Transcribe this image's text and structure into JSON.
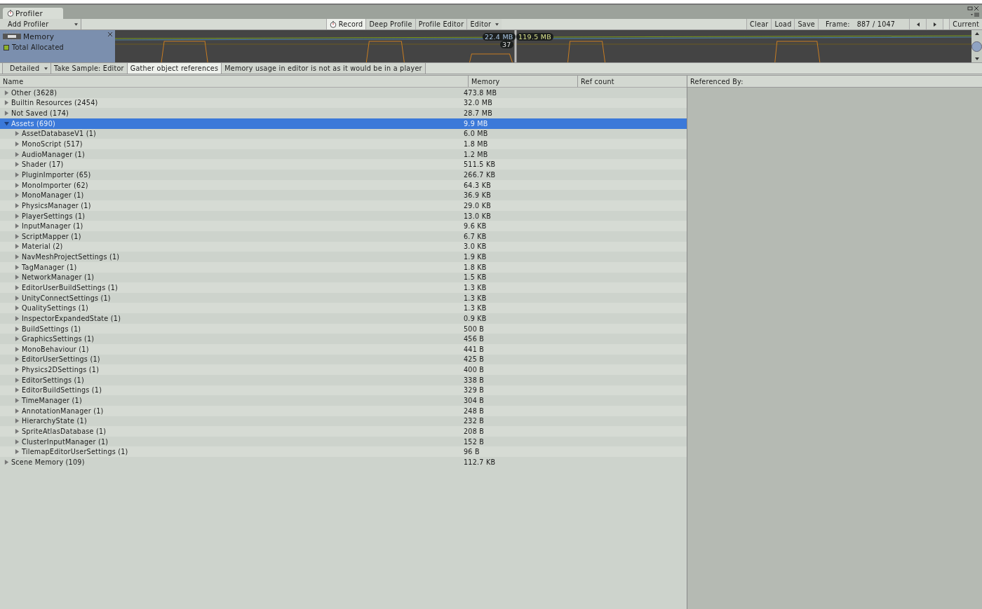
{
  "window": {
    "tab": "Profiler"
  },
  "toolbar": {
    "add_profiler": "Add Profiler",
    "buttons": [
      {
        "label": "Record",
        "kind": "record",
        "selected": true
      },
      {
        "label": "Deep Profile",
        "kind": "plain",
        "selected": false
      },
      {
        "label": "Profile Editor",
        "kind": "plain",
        "selected": false
      },
      {
        "label": "Editor",
        "kind": "dropdown",
        "selected": false
      }
    ],
    "right_buttons": [
      "Clear",
      "Load",
      "Save"
    ],
    "frame_label": "Frame:",
    "frame_value": "887 / 1047",
    "current": "Current"
  },
  "memory_panel": {
    "title": "Memory",
    "legend": [
      {
        "label": "Total Allocated",
        "color": "#8db32c"
      }
    ],
    "tooltips": [
      {
        "text": "22.4 MB",
        "kind": "blue"
      },
      {
        "text": "119.5 MB",
        "kind": "green"
      },
      {
        "text": "37",
        "kind": "plain"
      }
    ]
  },
  "detail_bar": {
    "mode": "Detailed",
    "buttons": [
      {
        "label": "Take Sample: Editor",
        "selected": false
      },
      {
        "label": "Gather object references",
        "selected": true
      }
    ],
    "notice": "Memory usage in editor is not as it would be in a player"
  },
  "table": {
    "columns": [
      "Name",
      "Memory",
      "Ref count"
    ],
    "rows": [
      {
        "name": "Other (3628)",
        "memory": "473.8 MB",
        "expanded": false,
        "selected": false
      },
      {
        "name": "Builtin Resources (2454)",
        "memory": "32.0 MB",
        "expanded": false,
        "selected": false
      },
      {
        "name": "Not Saved (174)",
        "memory": "28.7 MB",
        "expanded": false,
        "selected": false
      },
      {
        "name": "Assets (690)",
        "memory": "9.9 MB",
        "expanded": true,
        "selected": true,
        "children": [
          {
            "name": "AssetDatabaseV1 (1)",
            "memory": "6.0 MB",
            "expanded": false,
            "selected": false
          },
          {
            "name": "MonoScript (517)",
            "memory": "1.8 MB",
            "expanded": false,
            "selected": false
          },
          {
            "name": "AudioManager (1)",
            "memory": "1.2 MB",
            "expanded": false,
            "selected": false
          },
          {
            "name": "Shader (17)",
            "memory": "511.5 KB",
            "expanded": false,
            "selected": false
          },
          {
            "name": "PluginImporter (65)",
            "memory": "266.7 KB",
            "expanded": false,
            "selected": false
          },
          {
            "name": "MonoImporter (62)",
            "memory": "64.3 KB",
            "expanded": false,
            "selected": false
          },
          {
            "name": "MonoManager (1)",
            "memory": "36.9 KB",
            "expanded": false,
            "selected": false
          },
          {
            "name": "PhysicsManager (1)",
            "memory": "29.0 KB",
            "expanded": false,
            "selected": false
          },
          {
            "name": "PlayerSettings (1)",
            "memory": "13.0 KB",
            "expanded": false,
            "selected": false
          },
          {
            "name": "InputManager (1)",
            "memory": "9.6 KB",
            "expanded": false,
            "selected": false
          },
          {
            "name": "ScriptMapper (1)",
            "memory": "6.7 KB",
            "expanded": false,
            "selected": false
          },
          {
            "name": "Material (2)",
            "memory": "3.0 KB",
            "expanded": false,
            "selected": false
          },
          {
            "name": "NavMeshProjectSettings (1)",
            "memory": "1.9 KB",
            "expanded": false,
            "selected": false
          },
          {
            "name": "TagManager (1)",
            "memory": "1.8 KB",
            "expanded": false,
            "selected": false
          },
          {
            "name": "NetworkManager (1)",
            "memory": "1.5 KB",
            "expanded": false,
            "selected": false
          },
          {
            "name": "EditorUserBuildSettings (1)",
            "memory": "1.3 KB",
            "expanded": false,
            "selected": false
          },
          {
            "name": "UnityConnectSettings (1)",
            "memory": "1.3 KB",
            "expanded": false,
            "selected": false
          },
          {
            "name": "QualitySettings (1)",
            "memory": "1.3 KB",
            "expanded": false,
            "selected": false
          },
          {
            "name": "InspectorExpandedState (1)",
            "memory": "0.9 KB",
            "expanded": false,
            "selected": false
          },
          {
            "name": "BuildSettings (1)",
            "memory": "500 B",
            "expanded": false,
            "selected": false
          },
          {
            "name": "GraphicsSettings (1)",
            "memory": "456 B",
            "expanded": false,
            "selected": false
          },
          {
            "name": "MonoBehaviour (1)",
            "memory": "441 B",
            "expanded": false,
            "selected": false
          },
          {
            "name": "EditorUserSettings (1)",
            "memory": "425 B",
            "expanded": false,
            "selected": false
          },
          {
            "name": "Physics2DSettings (1)",
            "memory": "400 B",
            "expanded": false,
            "selected": false
          },
          {
            "name": "EditorSettings (1)",
            "memory": "338 B",
            "expanded": false,
            "selected": false
          },
          {
            "name": "EditorBuildSettings (1)",
            "memory": "329 B",
            "expanded": false,
            "selected": false
          },
          {
            "name": "TimeManager (1)",
            "memory": "304 B",
            "expanded": false,
            "selected": false
          },
          {
            "name": "AnnotationManager (1)",
            "memory": "248 B",
            "expanded": false,
            "selected": false
          },
          {
            "name": "HierarchyState (1)",
            "memory": "232 B",
            "expanded": false,
            "selected": false
          },
          {
            "name": "SpriteAtlasDatabase (1)",
            "memory": "208 B",
            "expanded": false,
            "selected": false
          },
          {
            "name": "ClusterInputManager (1)",
            "memory": "152 B",
            "expanded": false,
            "selected": false
          },
          {
            "name": "TilemapEditorUserSettings (1)",
            "memory": "96 B",
            "expanded": false,
            "selected": false
          }
        ]
      },
      {
        "name": "Scene Memory (109)",
        "memory": "112.7 KB",
        "expanded": false,
        "selected": false
      }
    ]
  },
  "referenced_by": {
    "title": "Referenced By:"
  }
}
